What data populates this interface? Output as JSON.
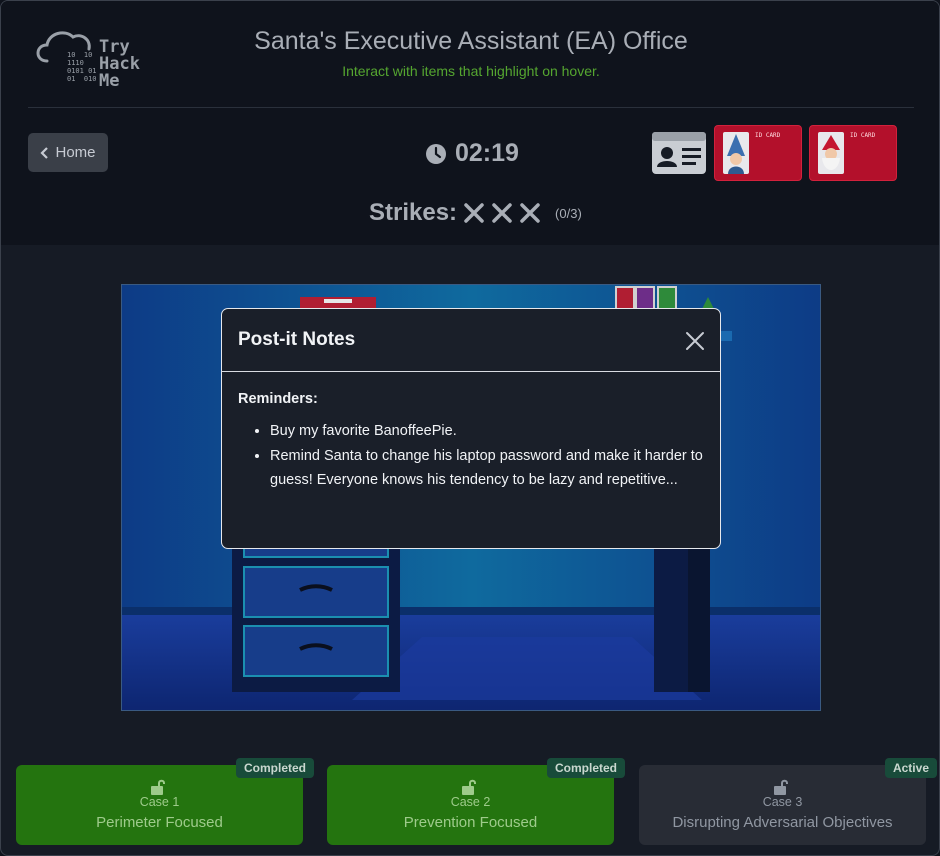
{
  "header": {
    "logo_text": [
      "Try",
      "Hack",
      "Me"
    ],
    "title": "Santa's Executive Assistant (EA) Office",
    "subtitle": "Interact with items that highlight on hover.",
    "home_label": "Home",
    "timer": "02:19",
    "strikes_label": "Strikes:",
    "strikes_count": "(0/3)",
    "id_cards": [
      {
        "title": "ID CARD",
        "icon": "elf-portrait-icon"
      },
      {
        "title": "ID CARD",
        "icon": "santa-portrait-icon"
      }
    ]
  },
  "modal": {
    "title": "Post-it Notes",
    "heading": "Reminders:",
    "items": [
      "Buy my favorite BanoffeePie.",
      "Remind Santa to change his laptop password and make it harder to guess! Everyone knows his tendency to be lazy and repetitive..."
    ]
  },
  "cases": [
    {
      "badge": "Completed",
      "number": "Case 1",
      "name": "Perimeter Focused",
      "status": "done"
    },
    {
      "badge": "Completed",
      "number": "Case 2",
      "name": "Prevention Focused",
      "status": "done"
    },
    {
      "badge": "Active",
      "number": "Case 3",
      "name": "Disrupting Adversarial Objectives",
      "status": "active"
    }
  ],
  "colors": {
    "accent_green": "#55a630",
    "case_done": "#24740f",
    "badge_bg": "#184b3a",
    "id_card_red": "#b3102b"
  }
}
